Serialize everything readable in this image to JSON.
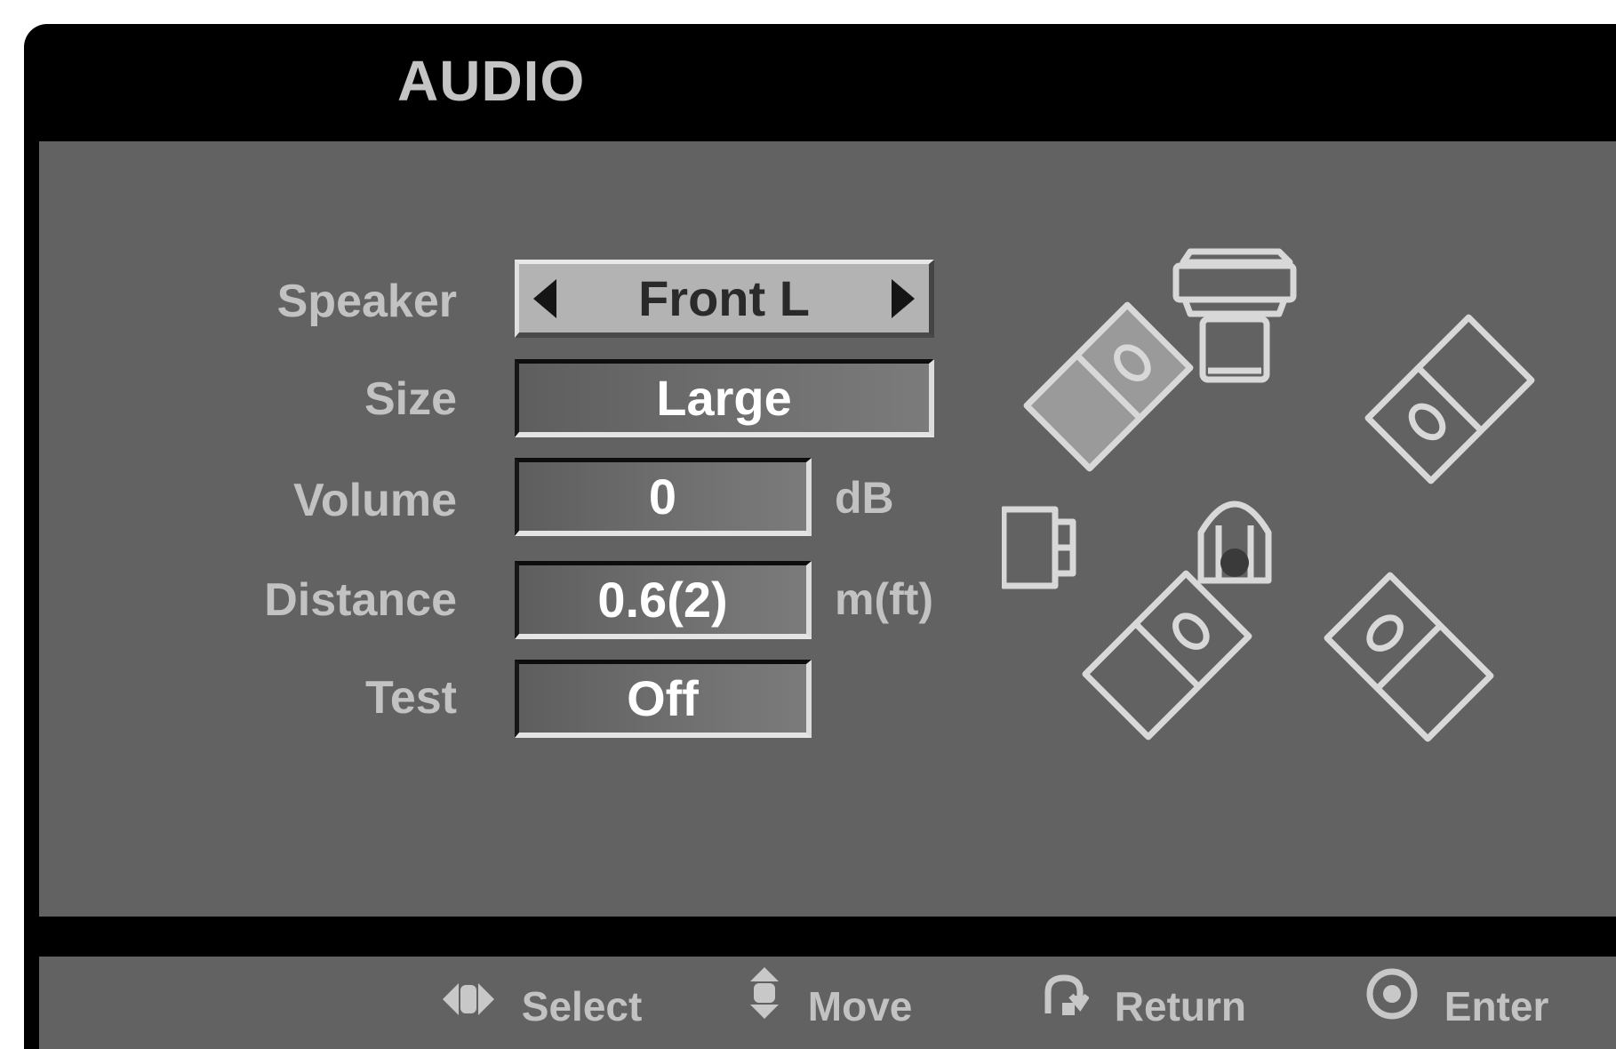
{
  "menu": {
    "title": "AUDIO"
  },
  "settings": {
    "speaker": {
      "label": "Speaker",
      "value": "Front L"
    },
    "size": {
      "label": "Size",
      "value": "Large"
    },
    "volume": {
      "label": "Volume",
      "value": "0",
      "unit": "dB"
    },
    "distance": {
      "label": "Distance",
      "value": "0.6(2)",
      "unit": "m(ft)"
    },
    "test": {
      "label": "Test",
      "value": "Off"
    }
  },
  "speaker_layout": {
    "speakers": [
      "front-left",
      "center",
      "front-right",
      "left-side",
      "listener",
      "rear-left",
      "rear-right"
    ],
    "highlighted": "front-left"
  },
  "footer": {
    "select": {
      "label": "Select",
      "icon": "left-right-arrows-icon"
    },
    "move": {
      "label": "Move",
      "icon": "up-down-arrows-icon"
    },
    "return": {
      "label": "Return",
      "icon": "return-arrow-icon"
    },
    "enter": {
      "label": "Enter",
      "icon": "enter-circle-icon"
    }
  },
  "colors": {
    "frame": "#000000",
    "panel": "#626262",
    "selected_field": "#b3b3b3",
    "field": "#6a6a6a",
    "text": "#c2c2c2"
  }
}
